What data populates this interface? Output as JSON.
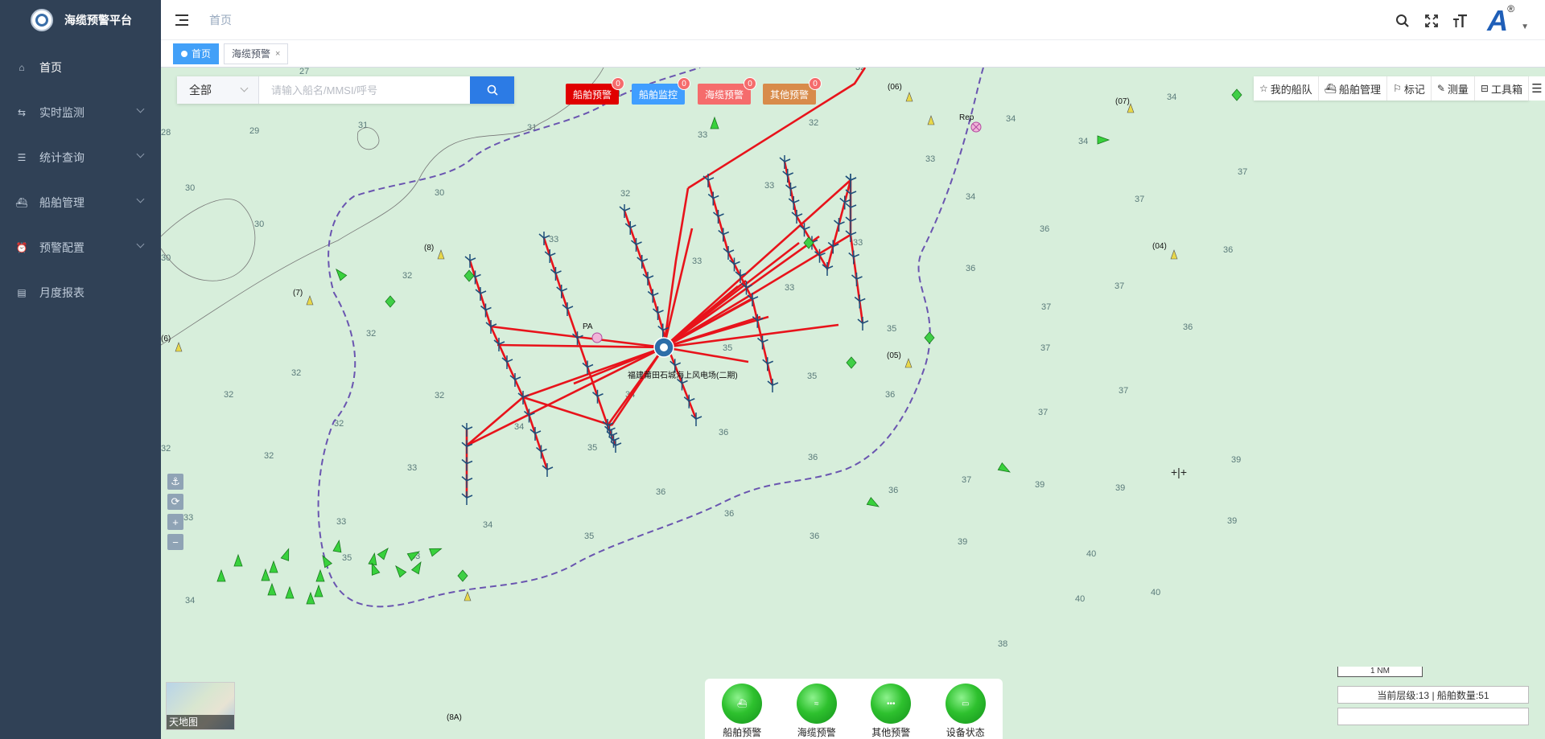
{
  "app": {
    "title": "海缆预警平台"
  },
  "sidebar": {
    "items": [
      {
        "label": "首页",
        "icon": "home-icon"
      },
      {
        "label": "实时监测",
        "icon": "monitor-icon"
      },
      {
        "label": "统计查询",
        "icon": "database-icon"
      },
      {
        "label": "船舶管理",
        "icon": "ship-icon"
      },
      {
        "label": "预警配置",
        "icon": "alarm-icon"
      },
      {
        "label": "月度报表",
        "icon": "report-icon"
      }
    ]
  },
  "header": {
    "breadcrumb": "首页"
  },
  "tags": [
    {
      "label": "首页",
      "active": true
    },
    {
      "label": "海缆预警",
      "active": false
    }
  ],
  "search": {
    "type_selected": "全部",
    "placeholder": "请输入船名/MMSI/呼号"
  },
  "alerts": [
    {
      "label": "船舶预警",
      "count": "0",
      "color": "#e00000"
    },
    {
      "label": "船舶监控",
      "count": "0",
      "color": "#409eff"
    },
    {
      "label": "海缆预警",
      "count": "0",
      "color": "#f56c6c"
    },
    {
      "label": "其他预警",
      "count": "0",
      "color": "#d88b4a"
    }
  ],
  "map_tools": {
    "my_fleet": "我的船队",
    "ship_mgmt": "船舶管理",
    "mark": "标记",
    "measure": "测量",
    "toolbox": "工具箱"
  },
  "map": {
    "basemap_label": "天地图",
    "scale_label": "1 NM",
    "status_text": "当前层级:13 | 船舶数量:51",
    "station_label": "福建莆田石城海上风电场(二期)",
    "point_labels": [
      "(06)",
      "(07)",
      "(8)",
      "(7)",
      "(6)",
      "(04)",
      "(05)",
      "(8A)",
      "Rep",
      "PA"
    ]
  },
  "bottom_buttons": [
    {
      "label": "船舶预警"
    },
    {
      "label": "海缆预警"
    },
    {
      "label": "其他预警"
    },
    {
      "label": "设备状态"
    }
  ]
}
